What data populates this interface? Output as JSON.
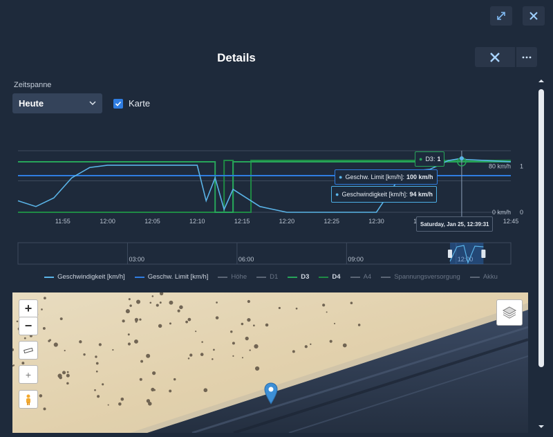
{
  "dialog": {
    "title": "Details"
  },
  "controls": {
    "range_label": "Zeitspanne",
    "range_value": "Heute",
    "map_checkbox_label": "Karte"
  },
  "chart_data": {
    "type": "line",
    "title": "",
    "xlabel": "",
    "ylabel": "",
    "x_ticks": [
      "11:55",
      "12:00",
      "12:05",
      "12:10",
      "12:15",
      "12:20",
      "12:25",
      "12:30",
      "12:35",
      "12:40",
      "12:45"
    ],
    "xlim": [
      "11:50",
      "12:45"
    ],
    "y_left_ticks": [
      "0 km/h",
      "80 km/h"
    ],
    "y_right_ticks": [
      "0",
      "1"
    ],
    "grid": true,
    "legend_position": "bottom",
    "series": [
      {
        "name": "Geschwindigkeit [km/h]",
        "color": "#5ab4e8",
        "x": [
          "11:50",
          "11:52",
          "11:54",
          "11:56",
          "11:58",
          "12:00",
          "12:05",
          "12:10",
          "12:11",
          "12:12",
          "12:13",
          "12:14",
          "12:17",
          "12:20",
          "12:25",
          "12:30",
          "12:33",
          "12:36",
          "12:38",
          "12:39:31",
          "12:40",
          "12:45"
        ],
        "values": [
          20,
          10,
          25,
          60,
          78,
          82,
          82,
          82,
          20,
          60,
          5,
          40,
          10,
          0,
          0,
          0,
          70,
          75,
          90,
          94,
          92,
          88
        ]
      },
      {
        "name": "Geschw. Limit [km/h]",
        "color": "#2f7de1",
        "x": [
          "11:50",
          "12:39:31",
          "12:45"
        ],
        "values": [
          100,
          100,
          100
        ]
      },
      {
        "name": "Höhe",
        "enabled": false
      },
      {
        "name": "D1",
        "enabled": false
      },
      {
        "name": "D3",
        "color": "#27a55a",
        "x": [
          "11:50",
          "12:11",
          "12:12",
          "12:14",
          "12:15",
          "12:25",
          "12:39:31",
          "12:45"
        ],
        "values": [
          1,
          1,
          0,
          1,
          1,
          1,
          1,
          1
        ]
      },
      {
        "name": "D4",
        "color": "#1f8a45",
        "x": [
          "11:50",
          "12:13",
          "12:14",
          "12:16",
          "12:45"
        ],
        "values": [
          0,
          1,
          0,
          1,
          1
        ]
      },
      {
        "name": "A4",
        "enabled": false
      },
      {
        "name": "Spannungsversorgung",
        "enabled": false
      },
      {
        "name": "Akku",
        "enabled": false
      }
    ],
    "navigator_ticks": [
      "03:00",
      "06:00",
      "09:00",
      "12:00"
    ],
    "tooltip": {
      "time": "Saturday, Jan 25, 12:39:31",
      "items": [
        {
          "label": "D3:",
          "value": "1"
        },
        {
          "label": "Geschw. Limit [km/h]:",
          "value": "100 km/h"
        },
        {
          "label": "Geschwindigkeit [km/h]:",
          "value": "94 km/h"
        }
      ]
    }
  },
  "map": {
    "zoom_in": "+",
    "zoom_out": "−",
    "locate": "+"
  }
}
